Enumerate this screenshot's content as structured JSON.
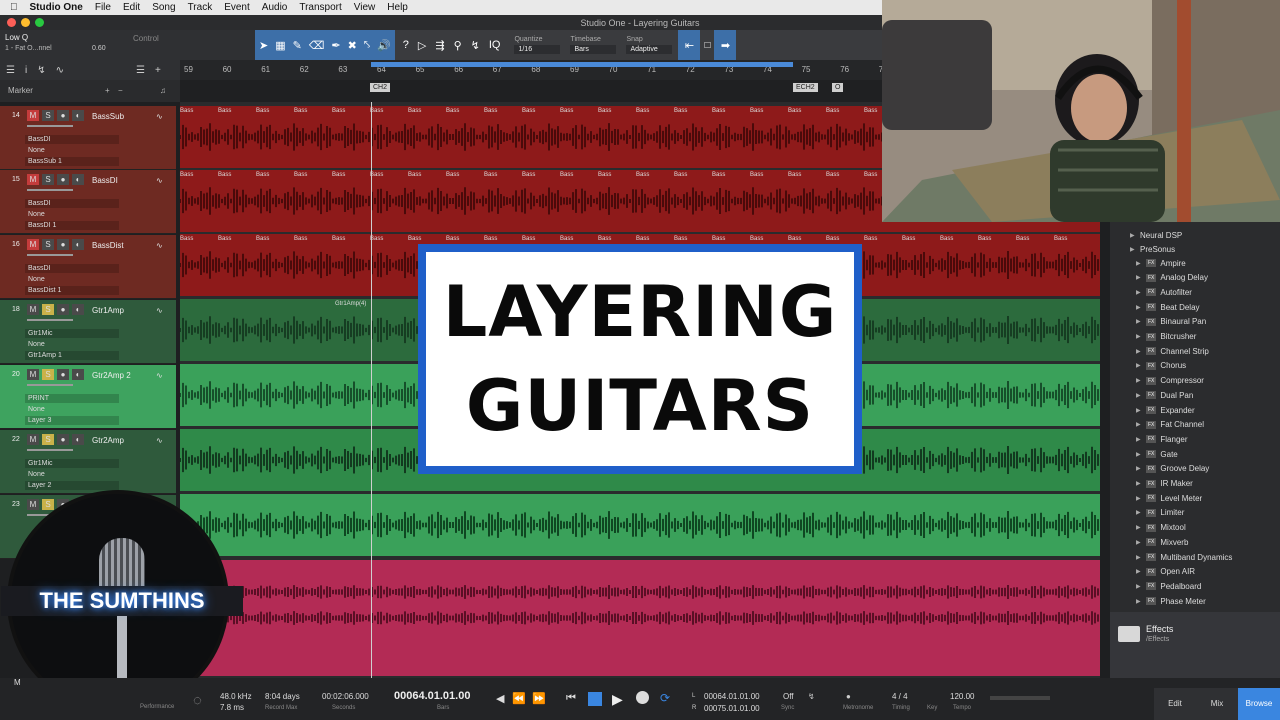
{
  "menubar": {
    "app": "Studio One",
    "items": [
      "File",
      "Edit",
      "Song",
      "Track",
      "Event",
      "Audio",
      "Transport",
      "View",
      "Help"
    ]
  },
  "window": {
    "title": "Studio One - Layering Guitars"
  },
  "toolbar": {
    "preset": "Low Q",
    "preset_sub": "1 - Fat O...nnel",
    "preset_value": "0.60",
    "control_label": "Control",
    "iq": "IQ",
    "quantize_label": "Quantize",
    "quantize_value": "1/16",
    "timebase_label": "Timebase",
    "timebase_value": "Bars",
    "snap_label": "Snap",
    "snap_value": "Adaptive"
  },
  "marker_bar": {
    "label": "Marker",
    "plus": "+",
    "minus": "−"
  },
  "ruler": {
    "numbers": [
      "59",
      "60",
      "61",
      "62",
      "63",
      "64",
      "65",
      "66",
      "67",
      "68",
      "69",
      "70",
      "71",
      "72",
      "73",
      "74",
      "75",
      "76",
      "77"
    ]
  },
  "markers": [
    "CH2",
    "ECH2",
    "O"
  ],
  "tracks": [
    {
      "num": "14",
      "name": "BassSub",
      "inst": "BassDI",
      "sub1": "None",
      "sub2": "BassSub 1"
    },
    {
      "num": "15",
      "name": "BassDI",
      "inst": "BassDI",
      "sub1": "None",
      "sub2": "BassDI 1"
    },
    {
      "num": "16",
      "name": "BassDist",
      "inst": "BassDI",
      "sub1": "None",
      "sub2": "BassDist 1"
    },
    {
      "num": "18",
      "name": "Gtr1Amp",
      "inst": "Gtr1Mic",
      "sub1": "None",
      "sub2": "Gtr1Amp 1"
    },
    {
      "num": "20",
      "name": "Gtr2Amp 2",
      "inst": "PRINT",
      "sub1": "None",
      "sub2": "Layer 3"
    },
    {
      "num": "22",
      "name": "Gtr2Amp",
      "inst": "Gtr1Mic",
      "sub1": "None",
      "sub2": "Layer 2"
    },
    {
      "num": "23",
      "name": "",
      "inst": "",
      "sub1": "",
      "sub2": ""
    }
  ],
  "clip_labels": {
    "bass": "Bass",
    "gtr": "Gtr1Amp(4)"
  },
  "title_card": {
    "line1": "LAYERING",
    "line2": "GUITARS"
  },
  "logo": {
    "text": "THE SUMTHINS"
  },
  "browser": {
    "vendors": [
      "Neural DSP",
      "PreSonus"
    ],
    "fx_tag": "FX",
    "plugins": [
      "Ampire",
      "Analog Delay",
      "Autofilter",
      "Beat Delay",
      "Binaural Pan",
      "Bitcrusher",
      "Channel Strip",
      "Chorus",
      "Compressor",
      "Dual Pan",
      "Expander",
      "Fat Channel",
      "Flanger",
      "Gate",
      "Groove Delay",
      "IR Maker",
      "Level Meter",
      "Limiter",
      "Mixtool",
      "Mixverb",
      "Multiband Dynamics",
      "Open AIR",
      "Pedalboard",
      "Phase Meter"
    ],
    "effects_title": "Effects",
    "effects_path": "/Effects"
  },
  "transport": {
    "performance_label": "Performance",
    "sample_rate": "48.0 kHz",
    "latency": "7.8 ms",
    "record_time": "8:04 days",
    "record_max_label": "Record Max",
    "seconds_time": "00:02:06.000",
    "seconds_label": "Seconds",
    "bars_time": "00064.01.01.00",
    "bars_label": "Bars",
    "loop_l": "00064.01.01.00",
    "loop_r": "00075.01.01.00",
    "l_label": "L",
    "r_label": "R",
    "sync_value": "Off",
    "sync_label": "Sync",
    "metronome_label": "Metronome",
    "timing_value": "4 / 4",
    "timing_label": "Timing",
    "key_label": "Key",
    "tempo_value": "120.00",
    "tempo_label": "Tempo",
    "m_label": "M"
  },
  "tabs": [
    "Edit",
    "Mix",
    "Browse"
  ],
  "colors": {
    "bass": "#8e1a1a",
    "gtr": "#2f8a49",
    "gtr_bright": "#3aa15a",
    "pink": "#b32b55",
    "accent": "#3a86e0",
    "card_border": "#1f5fc9"
  }
}
